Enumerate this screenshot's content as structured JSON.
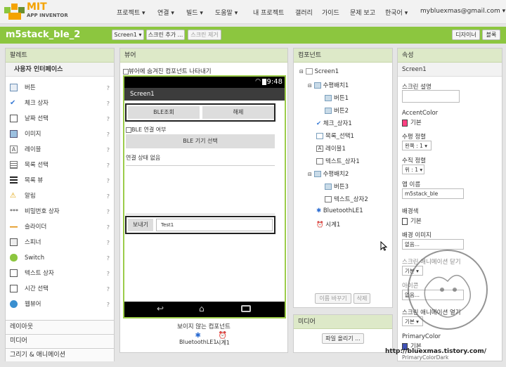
{
  "header": {
    "logo_top": "MIT",
    "logo_bottom": "APP INVENTOR",
    "nav": [
      "프로젝트 ▾",
      "연결 ▾",
      "빌드 ▾",
      "도움말 ▾",
      "내 프로젝트",
      "갤러리",
      "가이드",
      "문제 보고",
      "한국어 ▾",
      "mybluexmas@gmail.com ▾"
    ]
  },
  "toolbar": {
    "project": "m5stack_ble_2",
    "screen_select": "Screen1 ▾",
    "add_screen": "스크린 추가 ...",
    "remove_screen": "스크린 제거",
    "designer": "디자이너",
    "blocks": "블록"
  },
  "palette": {
    "title": "팔레트",
    "category": "사용자 인터페이스",
    "items": [
      "버튼",
      "체크 상자",
      "날짜 선택",
      "이미지",
      "레이블",
      "목록 선택",
      "목록 뷰",
      "알림",
      "비밀번호 상자",
      "슬라이더",
      "스피너",
      "Switch",
      "텍스트 상자",
      "시간 선택",
      "웹뷰어"
    ],
    "categories": [
      "레이아웃",
      "미디어",
      "그리기 & 애니메이션"
    ]
  },
  "viewer": {
    "title": "뷰어",
    "hidden_checkbox": "뷰어에 숨겨진 컴포넌트 나타내기",
    "clock": "9:48",
    "screen_title": "Screen1",
    "btn_scan": "BLE조회",
    "btn_disconnect": "해제",
    "ble_checkbox": "BLE 연결 여부",
    "ble_select": "BLE 기기 선택",
    "status": "연결 상태 없음",
    "send": "보내기",
    "test_text": "Test1",
    "nonvisible_title": "보이지 않는 컴포넌트",
    "nonvisible": [
      "BluetoothLE1",
      "시계1"
    ]
  },
  "components": {
    "title": "컴포넌트",
    "tree": [
      "Screen1",
      "수평배치1",
      "버튼1",
      "버튼2",
      "체크_상자1",
      "목록_선택1",
      "레이블1",
      "텍스트_상자1",
      "수평배치2",
      "버튼3",
      "텍스트_상자2",
      "BluetoothLE1",
      "시계1"
    ],
    "rename": "이름 바꾸기",
    "delete": "삭제"
  },
  "media": {
    "title": "미디어",
    "upload": "파일 올리기 ..."
  },
  "properties": {
    "title": "속성",
    "component": "Screen1",
    "screen_desc": "스크린 설명",
    "accent_color": "AccentColor",
    "accent_value": "기본",
    "halign": "수평 정렬",
    "halign_value": "왼쪽 : 1 ▾",
    "valign": "수직 정렬",
    "valign_value": "위 : 1 ▾",
    "app_name": "앱 이름",
    "app_name_value": "m5stack_ble",
    "bg_color": "배경색",
    "bg_color_value": "기본",
    "bg_image": "배경 이미지",
    "bg_image_value": "없음...",
    "close_anim": "스크린 애니메이션 닫기",
    "close_anim_value": "기본 ▾",
    "icon": "아이콘",
    "icon_value": "없음...",
    "open_anim": "스크린 애니메이션 열기",
    "open_anim_value": "기본 ▾",
    "primary_color": "PrimaryColor",
    "primary_color_value": "기본",
    "primary_dark": "PrimaryColorDark"
  },
  "watermark": "http://bluexmas.tistory.com/",
  "colors": {
    "accent": "#ff4081",
    "primary": "#3f51b5",
    "green": "#8cc63f"
  }
}
